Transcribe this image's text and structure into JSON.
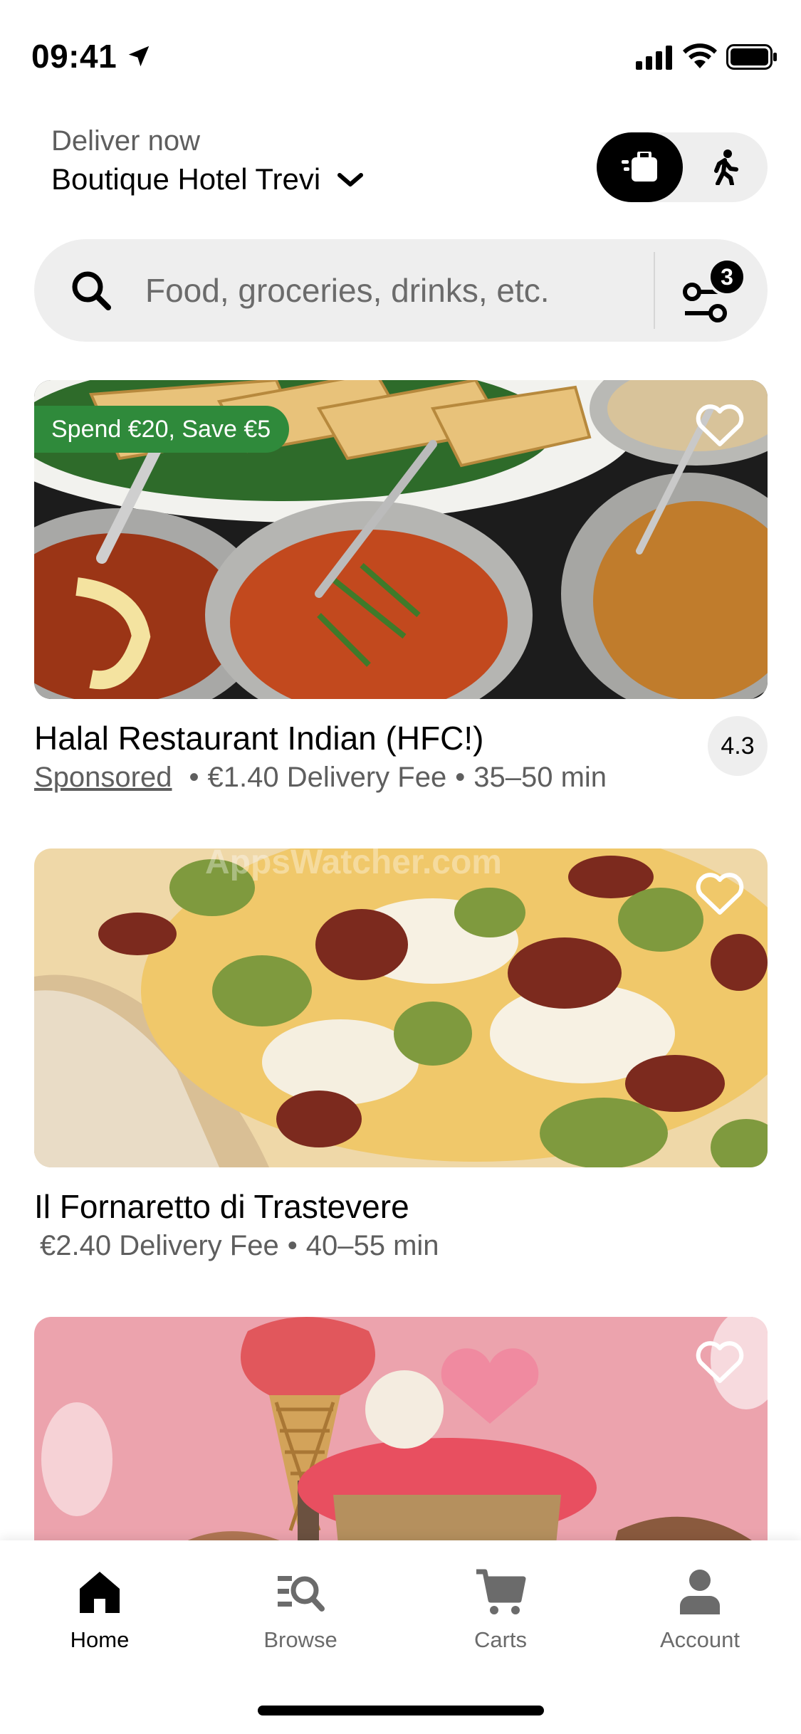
{
  "status_bar": {
    "time": "09:41"
  },
  "header": {
    "deliver_label": "Deliver now",
    "address": "Boutique Hotel Trevi",
    "modes": [
      {
        "name": "delivery",
        "icon": "delivery-bag-icon",
        "selected": true
      },
      {
        "name": "pickup",
        "icon": "walking-person-icon",
        "selected": false
      }
    ]
  },
  "search": {
    "placeholder": "Food, groceries, drinks, etc.",
    "value": "",
    "filter_badge": "3"
  },
  "restaurants": [
    {
      "name": "Halal Restaurant Indian (HFC!)",
      "promo": "Spend €20, Save €5",
      "sponsored": "Sponsored",
      "delivery_fee": "€1.40 Delivery Fee",
      "eta": "35–50 min",
      "rating": "4.3",
      "image": "indian-curries-and-naan"
    },
    {
      "name": "Il Fornaretto di Trastevere",
      "delivery_fee": "€2.40 Delivery Fee",
      "eta": "40–55 min",
      "image": "pizza-with-broccoli"
    },
    {
      "name": "",
      "image": "ice-cream-cones-pink-background"
    }
  ],
  "watermark": "AppsWatcher.com",
  "colors": {
    "promo_green": "#2f8a3b",
    "pill_grey": "#eeeeee",
    "text_secondary": "#5e5e5e"
  },
  "tabs": [
    {
      "label": "Home",
      "icon": "home-icon",
      "active": true
    },
    {
      "label": "Browse",
      "icon": "browse-icon",
      "active": false
    },
    {
      "label": "Carts",
      "icon": "cart-icon",
      "active": false
    },
    {
      "label": "Account",
      "icon": "account-icon",
      "active": false
    }
  ]
}
